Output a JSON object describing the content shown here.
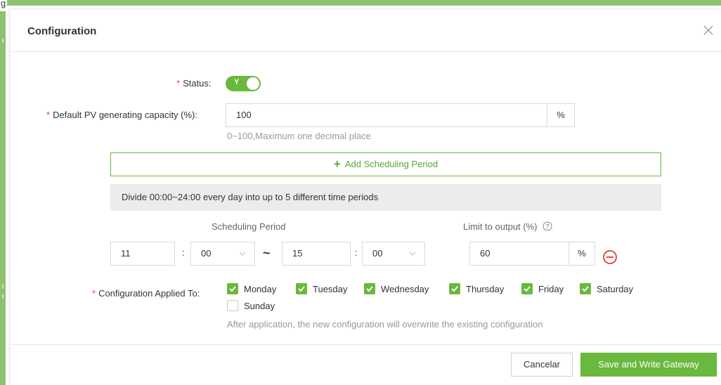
{
  "background": {
    "corner_char": "g"
  },
  "modal": {
    "title": "Configuration",
    "close_icon": "close-icon"
  },
  "status": {
    "label": "Status:",
    "toggle_text": "Y",
    "enabled": true
  },
  "pv_capacity": {
    "label": "Default PV generating capacity (%):",
    "value": "100",
    "unit": "%",
    "hint": "0~100,Maximum one decimal place"
  },
  "add_period": {
    "label": "Add Scheduling Period",
    "icon": "plus-icon"
  },
  "info": {
    "text": "Divide 00:00~24:00 every day into up to 5 different time periods"
  },
  "schedule": {
    "period_header": "Scheduling Period",
    "limit_header": "Limit to output (%)",
    "periods": [
      {
        "start_hour": "11",
        "start_minute": "00",
        "end_hour": "15",
        "end_minute": "00",
        "limit": "60",
        "limit_unit": "%",
        "separator": ":",
        "range_sep": "~"
      }
    ]
  },
  "applied_to": {
    "label": "Configuration Applied To:",
    "days": [
      {
        "label": "Monday",
        "checked": true
      },
      {
        "label": "Tuesday",
        "checked": true
      },
      {
        "label": "Wednesday",
        "checked": true
      },
      {
        "label": "Thursday",
        "checked": true
      },
      {
        "label": "Friday",
        "checked": true
      },
      {
        "label": "Saturday",
        "checked": true
      },
      {
        "label": "Sunday",
        "checked": false
      }
    ],
    "note": "After application, the new configuration will overwrite the existing configuration"
  },
  "footer": {
    "cancel_label": "Cancelar",
    "save_label": "Save and Write Gateway"
  },
  "colors": {
    "accent": "#6ab83e",
    "required": "#e64545",
    "remove": "#e53935",
    "frame": "#8dc26f"
  }
}
